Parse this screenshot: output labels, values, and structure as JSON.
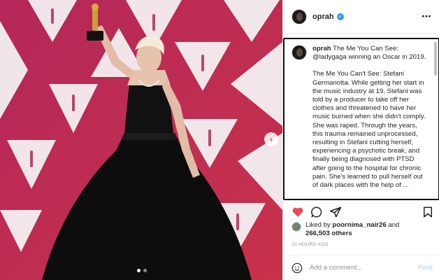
{
  "post": {
    "username": "oprah",
    "more_icon": "⋯",
    "caption": {
      "username": "oprah",
      "line1": " The Me You Can See: @ladygaga winning an Oscar in 2019.",
      "line2": "The Me You Can't See: Stefani Germanotta. While getting her start in the music industry at 19, Stefani was told by a producer to take off her clothes and threatened to have her music burned when she didn't comply. She was raped. Through the years, this trauma remained unprocessed, resulting in Stefani cutting herself, experiencing a psychotic break, and finally being diagnosed with PTSD after going to the hospital for chronic pain. She's learned to pull herself out of dark places with the help of ..."
    },
    "likes": {
      "prefix": "Liked by ",
      "liker": "poornima_nair26",
      "middle": " and",
      "count": "266,503 others"
    },
    "timestamp": "10 HOURS AGO",
    "comment": {
      "placeholder": "Add a comment...",
      "post_label": "Post"
    },
    "carousel": {
      "slide_count": 2,
      "active_index": 0
    }
  },
  "colors": {
    "like_red": "#ed4956",
    "verified_blue": "#3897f0",
    "post_disabled": "#b2dffc",
    "backdrop_magenta": "#b02a55"
  }
}
